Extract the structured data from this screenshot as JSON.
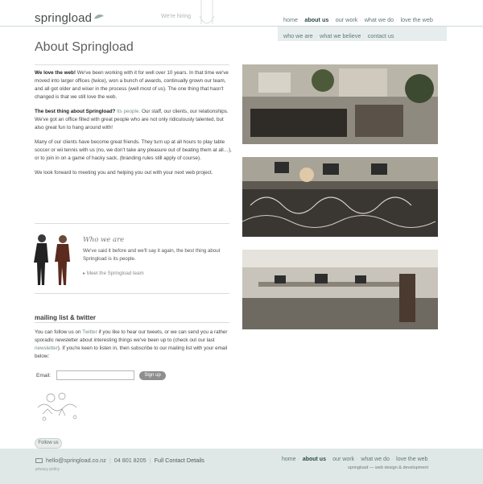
{
  "header": {
    "logo": "springload",
    "tagline": "We're hiring",
    "nav_primary": [
      "home",
      "about us",
      "our work",
      "what we do",
      "love the web"
    ],
    "nav_secondary": [
      "who we are",
      "what we believe",
      "contact us"
    ]
  },
  "page": {
    "title": "About Springload"
  },
  "intro": {
    "p1_lead": "We love the web!",
    "p1_text": " We've been working with it for well over 10 years. In that time we've moved into larger offices (twice), won a bunch of awards, continually grown our team, and all got older and wiser in the process (well most of us). The one thing that hasn't changed is that we still love the web.",
    "p2_lead": "The best thing about Springload?",
    "p2_link": "Its people.",
    "p2_text": " Our staff, our clients, our relationships. We've got an office filled with great people who are not only ridiculously talented, but also great fun to hang around with!",
    "p3": "Many of our clients have become great friends. They turn up at all hours to play table soccer or wii tennis with us (no, we don't take any pleasure out of beating them at all…), or to join in on a game of hacky sack, (branding rules still apply of course).",
    "p4": "We look forward to meeting you and helping you out with your next web project."
  },
  "who": {
    "title": "Who we are",
    "text": "We've said it before and we'll say it again, the best thing about Springload is its people.",
    "link": "Meet the Springload team"
  },
  "mailing": {
    "title": "mailing list & twitter",
    "t1": "You can follow us on ",
    "twitter": "Twitter",
    "t2": " if you like to hear our tweets, or we can send you a rather sporadic newsletter about interesting things we've been up to (check out our last ",
    "newsletter": "newsletter",
    "t3": "). If you're keen to listen in, then subscribe to our mailing list with your email below:",
    "email_label": "Email:",
    "email_value": "",
    "signup": "Sign up"
  },
  "footer": {
    "follow": "Follow us",
    "email": "hello@springload.co.nz",
    "phone": "04 801 8205",
    "contact_link": "Full Contact Details",
    "privacy": "privacy policy",
    "nav": [
      "home",
      "about us",
      "our work",
      "what we do",
      "love the web"
    ],
    "tag": "springload — web design & development"
  },
  "colors": {
    "nav": "#5a7a78",
    "footer_bg": "#dfe8e7"
  }
}
